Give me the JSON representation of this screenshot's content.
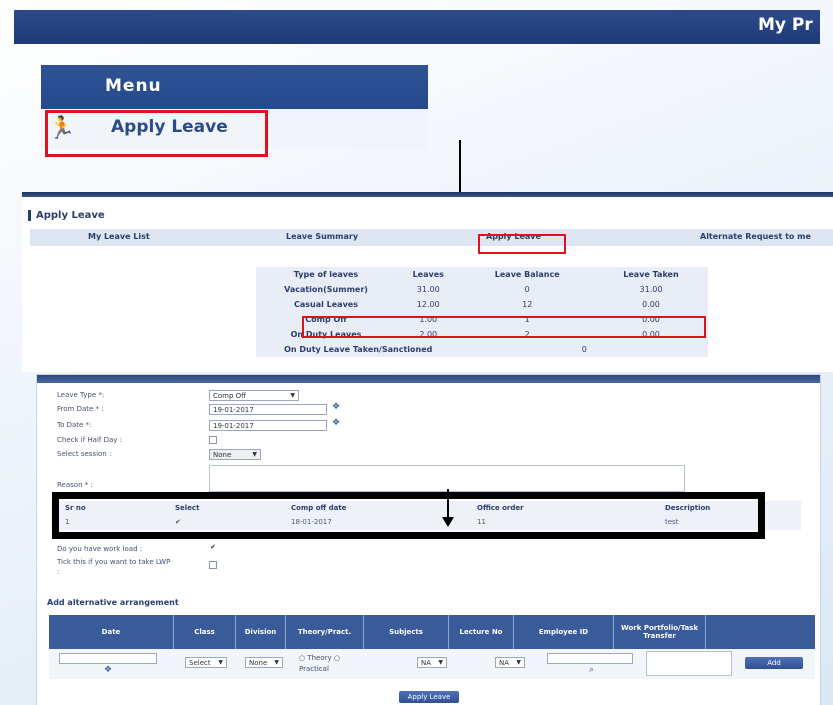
{
  "topbar": {
    "title": "My Pr"
  },
  "menu": {
    "header": "Menu",
    "item_label": "Apply Leave",
    "item_icon": "runner-icon"
  },
  "leave_page": {
    "title": "Apply Leave",
    "nav": [
      "My Leave List",
      "Leave Summary",
      "Apply Leave",
      "Alternate Request to me"
    ],
    "summary_headers": [
      "Type of leaves",
      "Leaves",
      "Leave Balance",
      "Leave Taken"
    ],
    "summary_rows": [
      {
        "type": "Vacation(Summer)",
        "leaves": "31.00",
        "balance": "0",
        "taken": "31.00"
      },
      {
        "type": "Casual Leaves",
        "leaves": "12.00",
        "balance": "12",
        "taken": "0.00"
      },
      {
        "type": "Comp Off",
        "leaves": "1.00",
        "balance": "1",
        "taken": "0.00"
      },
      {
        "type": "On Duty Leaves",
        "leaves": "2.00",
        "balance": "2",
        "taken": "0.00"
      }
    ],
    "duty_taken_label": "On Duty Leave Taken/Sanctioned",
    "duty_taken_value": "0"
  },
  "form": {
    "leave_type_label": "Leave Type *:",
    "leave_type_value": "Comp Off",
    "from_date_label": "From Date * :",
    "from_date_value": "19-01-2017",
    "to_date_label": "To Date *:",
    "to_date_value": "19-01-2017",
    "half_day_label": "Check if Half Day :",
    "session_label": "Select session :",
    "session_value": "None",
    "reason_label": "Reason * :",
    "compoff_headers": [
      "Sr no",
      "Select",
      "Comp off date",
      "Office order",
      "Description"
    ],
    "compoff_row": [
      "1",
      "✔",
      "18-01-2017",
      "11",
      "test"
    ],
    "work_load_label": "Do you have work load :",
    "lwp_label": "Tick this if you want to take LWP",
    "lwp_label2": ":",
    "alt_title": "Add alternative arrangement",
    "alt_headers": [
      "Date",
      "Class",
      "Division",
      "Theory/Pract.",
      "Subjects",
      "Lecture No",
      "Employee ID",
      "Work Portfolio/Task Transfer"
    ],
    "alt_class_value": "Select",
    "alt_division_value": "None",
    "alt_theory": "Theory",
    "alt_practical": "Practical",
    "alt_subject_value": "NA",
    "alt_lecture_value": "NA",
    "add_button": "Add",
    "apply_button": "Apply Leave"
  },
  "colors": {
    "header_blue": "#1e3a78",
    "highlight_red": "#e0121c",
    "annotation_black": "#000000"
  }
}
